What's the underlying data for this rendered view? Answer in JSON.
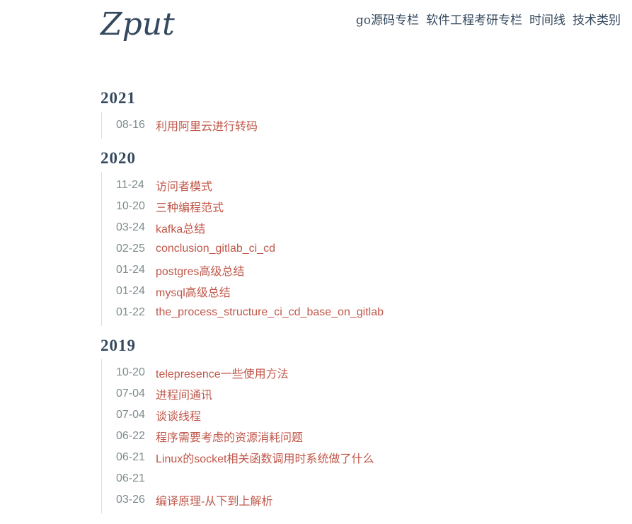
{
  "site": {
    "logo": "Zput"
  },
  "nav": [
    {
      "label": "go源码专栏"
    },
    {
      "label": "软件工程考研专栏"
    },
    {
      "label": "时间线"
    },
    {
      "label": "技术类别"
    }
  ],
  "archive": [
    {
      "year": "2021",
      "posts": [
        {
          "date": "08-16",
          "title": "利用阿里云进行转码"
        }
      ]
    },
    {
      "year": "2020",
      "posts": [
        {
          "date": "11-24",
          "title": "访问者模式"
        },
        {
          "date": "10-20",
          "title": "三种编程范式"
        },
        {
          "date": "03-24",
          "title": "kafka总结"
        },
        {
          "date": "02-25",
          "title": "conclusion_gitlab_ci_cd"
        },
        {
          "date": "01-24",
          "title": "postgres高级总结"
        },
        {
          "date": "01-24",
          "title": "mysql高级总结"
        },
        {
          "date": "01-22",
          "title": "the_process_structure_ci_cd_base_on_gitlab"
        }
      ]
    },
    {
      "year": "2019",
      "posts": [
        {
          "date": "10-20",
          "title": "telepresence一些使用方法"
        },
        {
          "date": "07-04",
          "title": "进程间通讯"
        },
        {
          "date": "07-04",
          "title": "谈谈线程"
        },
        {
          "date": "06-22",
          "title": "程序需要考虑的资源消耗问题"
        },
        {
          "date": "06-21",
          "title": "Linux的socket相关函数调用时系统做了什么"
        },
        {
          "date": "06-21",
          "title": ""
        },
        {
          "date": "03-26",
          "title": "编译原理-从下到上解析"
        }
      ]
    }
  ]
}
